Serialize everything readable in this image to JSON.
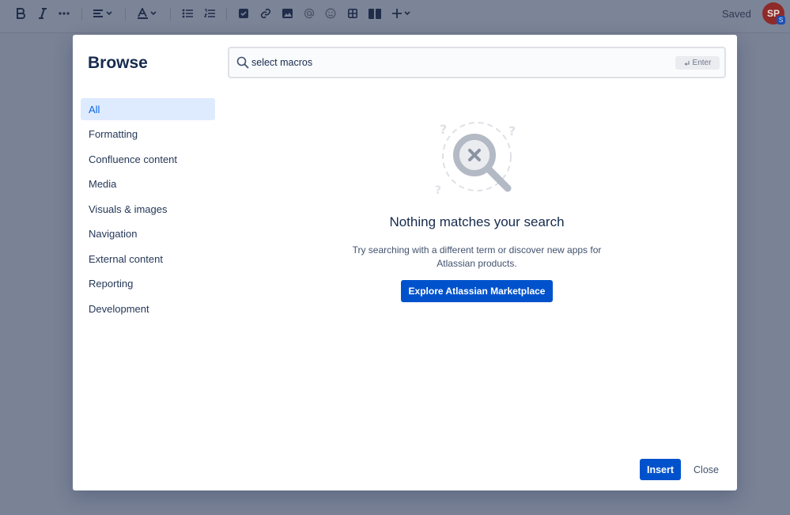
{
  "toolbar": {
    "items": [
      {
        "name": "bold-button",
        "icon": "bold-icon"
      },
      {
        "name": "italic-button",
        "icon": "italic-icon"
      },
      {
        "name": "more-formatting-button",
        "icon": "more-icon"
      },
      {
        "name": "text-align-button",
        "icon": "align-left-icon"
      },
      {
        "name": "text-color-button",
        "icon": "text-color-icon"
      },
      {
        "name": "bullet-list-button",
        "icon": "bullet-list-icon"
      },
      {
        "name": "numbered-list-button",
        "icon": "numbered-list-icon"
      },
      {
        "name": "action-item-button",
        "icon": "checkbox-icon"
      },
      {
        "name": "link-button",
        "icon": "link-icon"
      },
      {
        "name": "image-button",
        "icon": "image-icon"
      },
      {
        "name": "mention-button",
        "icon": "at-icon"
      },
      {
        "name": "emoji-button",
        "icon": "emoji-icon"
      },
      {
        "name": "table-button",
        "icon": "table-icon"
      },
      {
        "name": "layout-button",
        "icon": "columns-icon"
      },
      {
        "name": "insert-more-button",
        "icon": "plus-icon"
      }
    ],
    "saved_label": "Saved",
    "avatar_initials": "SP",
    "avatar_badge": "S"
  },
  "dialog": {
    "title": "Browse",
    "categories": [
      {
        "label": "All",
        "selected": true
      },
      {
        "label": "Formatting",
        "selected": false
      },
      {
        "label": "Confluence content",
        "selected": false
      },
      {
        "label": "Media",
        "selected": false
      },
      {
        "label": "Visuals & images",
        "selected": false
      },
      {
        "label": "Navigation",
        "selected": false
      },
      {
        "label": "External content",
        "selected": false
      },
      {
        "label": "Reporting",
        "selected": false
      },
      {
        "label": "Development",
        "selected": false
      }
    ],
    "search": {
      "value": "select macros",
      "enter_hint": "Enter"
    },
    "empty_state": {
      "title": "Nothing matches your search",
      "description": "Try searching with a different term or discover new apps for Atlassian products.",
      "button_label": "Explore Atlassian Marketplace"
    },
    "footer": {
      "insert_label": "Insert",
      "close_label": "Close"
    }
  },
  "colors": {
    "primary": "#0052cc",
    "selected_bg": "#deebff",
    "overlay": "#7a8296"
  }
}
